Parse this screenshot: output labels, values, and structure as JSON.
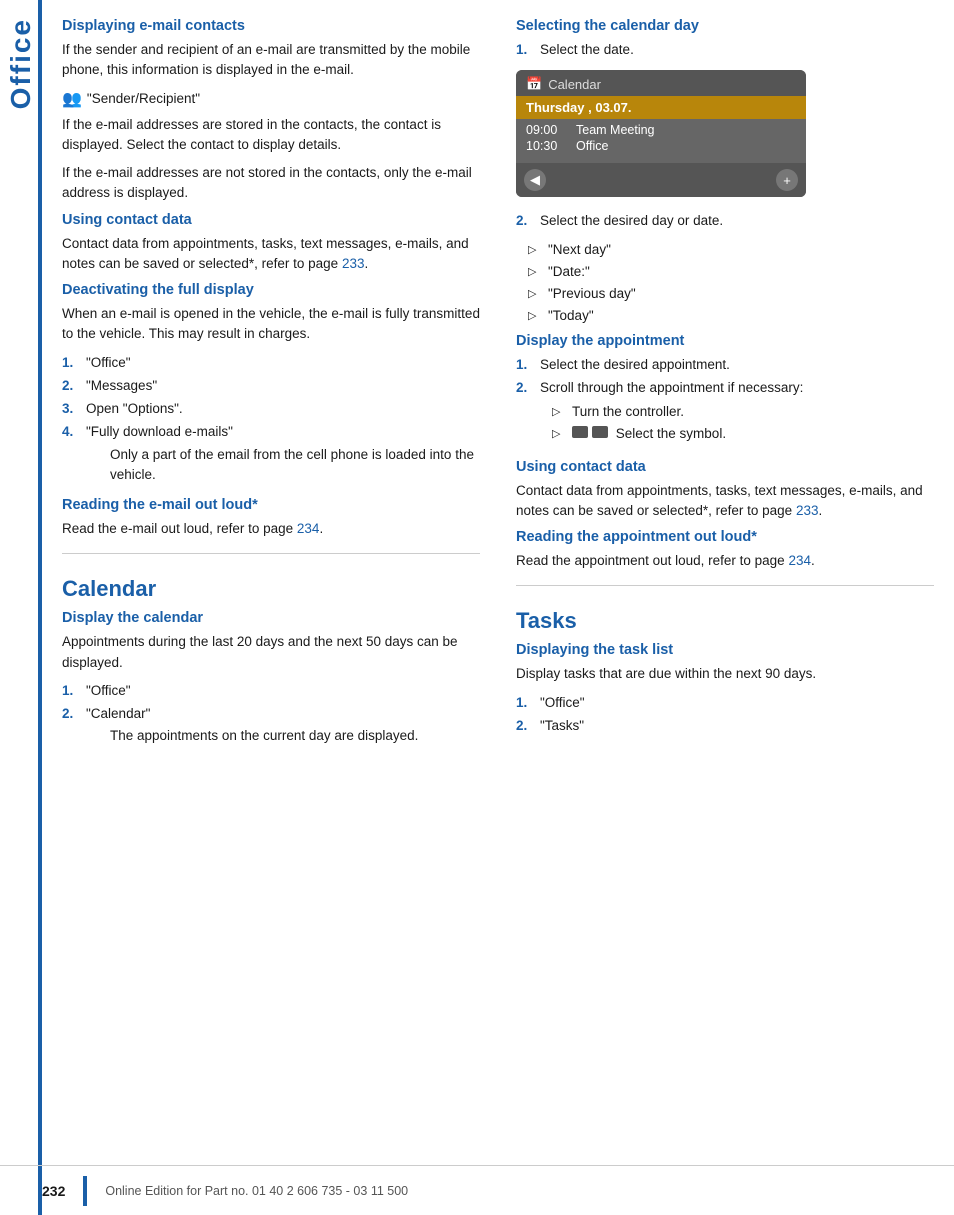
{
  "sidebar": {
    "label": "Office"
  },
  "left_col": {
    "sections": [
      {
        "id": "displaying-email-contacts",
        "title": "Displaying e-mail contacts",
        "paragraphs": [
          "If the sender and recipient of an e-mail are transmitted by the mobile phone, this information is displayed in the e-mail.",
          "If the e-mail addresses are stored in the contacts, the contact is displayed. Select the contact to display details.",
          "If the e-mail addresses are not stored in the contacts, only the e-mail address is displayed."
        ],
        "icon_line": "\"Sender/Recipient\""
      },
      {
        "id": "using-contact-data",
        "title": "Using contact data",
        "paragraph": "Contact data from appointments, tasks, text messages, e-mails, and notes can be saved or selected*, refer to page ",
        "link": "233",
        "paragraph_end": "."
      },
      {
        "id": "deactivating-full-display",
        "title": "Deactivating the full display",
        "paragraph": "When an e-mail is opened in the vehicle, the e-mail is fully transmitted to the vehicle. This may result in charges.",
        "steps": [
          {
            "num": "1.",
            "text": "\"Office\""
          },
          {
            "num": "2.",
            "text": "\"Messages\""
          },
          {
            "num": "3.",
            "text": "Open \"Options\"."
          },
          {
            "num": "4.",
            "text": "\"Fully download e-mails\"",
            "subtext": "Only a part of the email from the cell phone is loaded into the vehicle."
          }
        ]
      },
      {
        "id": "reading-email-loud",
        "title": "Reading the e-mail out loud*",
        "paragraph": "Read the e-mail out loud, refer to page ",
        "link": "234",
        "paragraph_end": "."
      }
    ],
    "calendar_section": {
      "id": "calendar",
      "title": "Calendar",
      "subsections": [
        {
          "id": "display-calendar",
          "title": "Display the calendar",
          "paragraph": "Appointments during the last 20 days and the next 50 days can be displayed.",
          "steps": [
            {
              "num": "1.",
              "text": "\"Office\""
            },
            {
              "num": "2.",
              "text": "\"Calendar\"",
              "subtext": "The appointments on the current day are displayed."
            }
          ]
        }
      ]
    }
  },
  "right_col": {
    "sections": [
      {
        "id": "selecting-calendar-day",
        "title": "Selecting the calendar day",
        "step1": "Select the date.",
        "calendar_widget": {
          "header": "Calendar",
          "date_row": "Thursday , 03.07.",
          "events": [
            {
              "time": "09:00",
              "title": "Team Meeting"
            },
            {
              "time": "10:30",
              "title": "Office"
            }
          ]
        },
        "step2": "Select the desired day or date.",
        "options": [
          "\"Next day\"",
          "\"Date:\"",
          "\"Previous day\"",
          "\"Today\""
        ]
      },
      {
        "id": "display-appointment",
        "title": "Display the appointment",
        "steps": [
          {
            "num": "1.",
            "text": "Select the desired appointment."
          },
          {
            "num": "2.",
            "text": "Scroll through the appointment if necessary:",
            "subbullets": [
              "Turn the controller.",
              "Select the symbol."
            ]
          }
        ]
      },
      {
        "id": "using-contact-data-2",
        "title": "Using contact data",
        "paragraph": "Contact data from appointments, tasks, text messages, e-mails, and notes can be saved or selected*, refer to page ",
        "link": "233",
        "paragraph_end": "."
      },
      {
        "id": "reading-appointment-loud",
        "title": "Reading the appointment out loud*",
        "paragraph": "Read the appointment out loud, refer to page ",
        "link": "234",
        "paragraph_end": "."
      }
    ],
    "tasks_section": {
      "id": "tasks",
      "title": "Tasks",
      "subsections": [
        {
          "id": "displaying-task-list",
          "title": "Displaying the task list",
          "paragraph": "Display tasks that are due within the next 90 days.",
          "steps": [
            {
              "num": "1.",
              "text": "\"Office\""
            },
            {
              "num": "2.",
              "text": "\"Tasks\""
            }
          ]
        }
      ]
    }
  },
  "footer": {
    "page_number": "232",
    "text": "Online Edition for Part no. 01 40 2 606 735 - 03 11 500"
  }
}
